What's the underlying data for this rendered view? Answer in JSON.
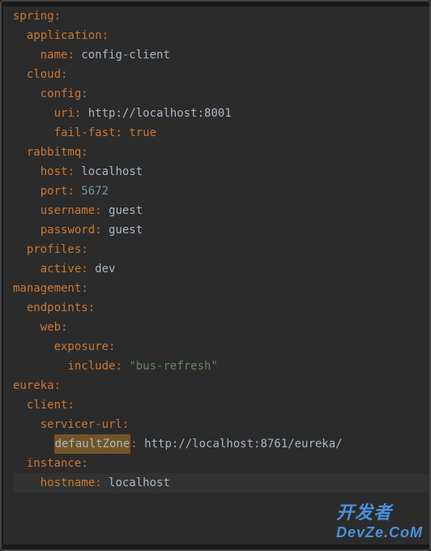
{
  "code": {
    "l1_key": "spring",
    "l1_colon": ":",
    "l2_key": "application",
    "l2_colon": ":",
    "l3_key": "name",
    "l3_colon": ": ",
    "l3_val": "config-client",
    "l4_key": "cloud",
    "l4_colon": ":",
    "l5_key": "config",
    "l5_colon": ":",
    "l6_key": "uri",
    "l6_colon": ": ",
    "l6_val": "http://localhost:8001",
    "l7_key": "fail-fast",
    "l7_colon": ": ",
    "l7_val": "true",
    "l8_key": "rabbitmq",
    "l8_colon": ":",
    "l9_key": "host",
    "l9_colon": ": ",
    "l9_val": "localhost",
    "l10_key": "port",
    "l10_colon": ": ",
    "l10_val": "5672",
    "l11_key": "username",
    "l11_colon": ": ",
    "l11_val": "guest",
    "l12_key": "password",
    "l12_colon": ": ",
    "l12_val": "guest",
    "l13_key": "profiles",
    "l13_colon": ":",
    "l14_key": "active",
    "l14_colon": ": ",
    "l14_val": "dev",
    "l15_key": "management",
    "l15_colon": ":",
    "l16_key": "endpoints",
    "l16_colon": ":",
    "l17_key": "web",
    "l17_colon": ":",
    "l18_key": "exposure",
    "l18_colon": ":",
    "l19_key": "include",
    "l19_colon": ": ",
    "l19_val": "\"bus-refresh\"",
    "l20_key": "eureka",
    "l20_colon": ":",
    "l21_key": "client",
    "l21_colon": ":",
    "l22_key": "servicer-url",
    "l22_colon": ":",
    "l23_key": "defaultZone",
    "l23_colon": ": ",
    "l23_val": "http://localhost:8761/eureka/",
    "l24_key": "instance",
    "l24_colon": ":",
    "l25_key": "hostname",
    "l25_colon": ": ",
    "l25_val": "localhost"
  },
  "indent": {
    "i1": "  ",
    "i2": "    ",
    "i3": "      ",
    "i4": "        "
  },
  "watermark": {
    "top": "开发者",
    "bot_a": "DevZe",
    "bot_b": ".",
    "bot_c": "CoM"
  }
}
